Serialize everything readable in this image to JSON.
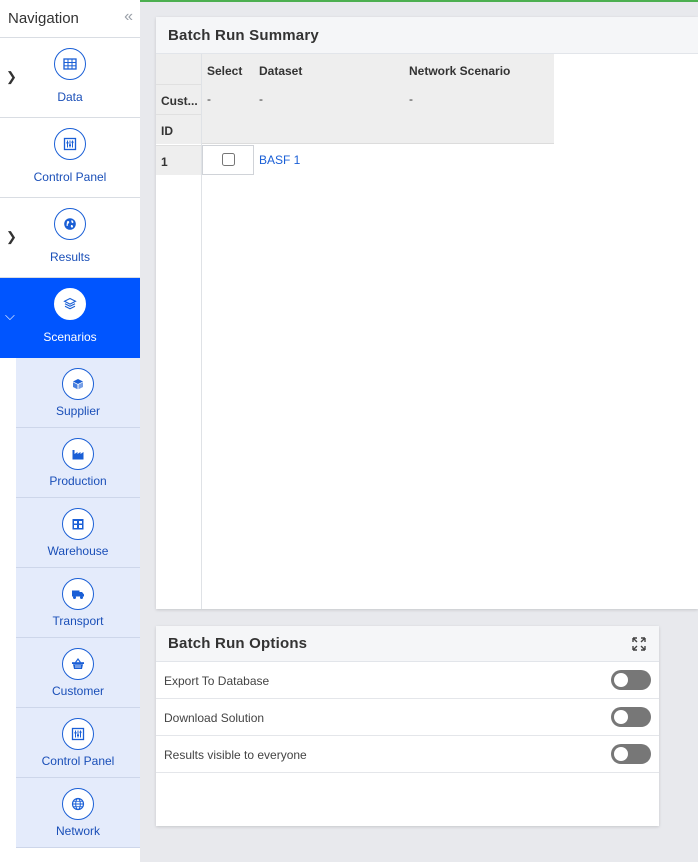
{
  "sidebar": {
    "title": "Navigation",
    "collapse_glyph": "«",
    "items": [
      {
        "label": "Data",
        "icon": "table-icon",
        "expandable": true
      },
      {
        "label": "Control Panel",
        "icon": "control-panel-icon",
        "expandable": false
      },
      {
        "label": "Results",
        "icon": "globe-icon",
        "expandable": true
      },
      {
        "label": "Scenarios",
        "icon": "layers-icon",
        "expandable": true,
        "active": true
      }
    ],
    "subitems": [
      {
        "label": "Supplier",
        "icon": "box-icon"
      },
      {
        "label": "Production",
        "icon": "factory-icon"
      },
      {
        "label": "Warehouse",
        "icon": "warehouse-icon"
      },
      {
        "label": "Transport",
        "icon": "truck-icon"
      },
      {
        "label": "Customer",
        "icon": "basket-icon"
      },
      {
        "label": "Control Panel",
        "icon": "control-panel-icon"
      },
      {
        "label": "Network",
        "icon": "network-globe-icon"
      }
    ],
    "accent_color": "#0055ff"
  },
  "summary": {
    "title": "Batch Run Summary",
    "columns": [
      "Select",
      "Dataset",
      "Network Scenario"
    ],
    "row_labels": [
      "Cust...",
      "ID"
    ],
    "customer_row": [
      "-",
      "-",
      "-"
    ],
    "rows": [
      {
        "id": "1",
        "selected": false,
        "dataset": "BASF 1"
      }
    ]
  },
  "options": {
    "title": "Batch Run Options",
    "items": [
      {
        "label": "Export To Database",
        "on": false
      },
      {
        "label": "Download Solution",
        "on": false
      },
      {
        "label": "Results visible to everyone",
        "on": false
      }
    ]
  }
}
